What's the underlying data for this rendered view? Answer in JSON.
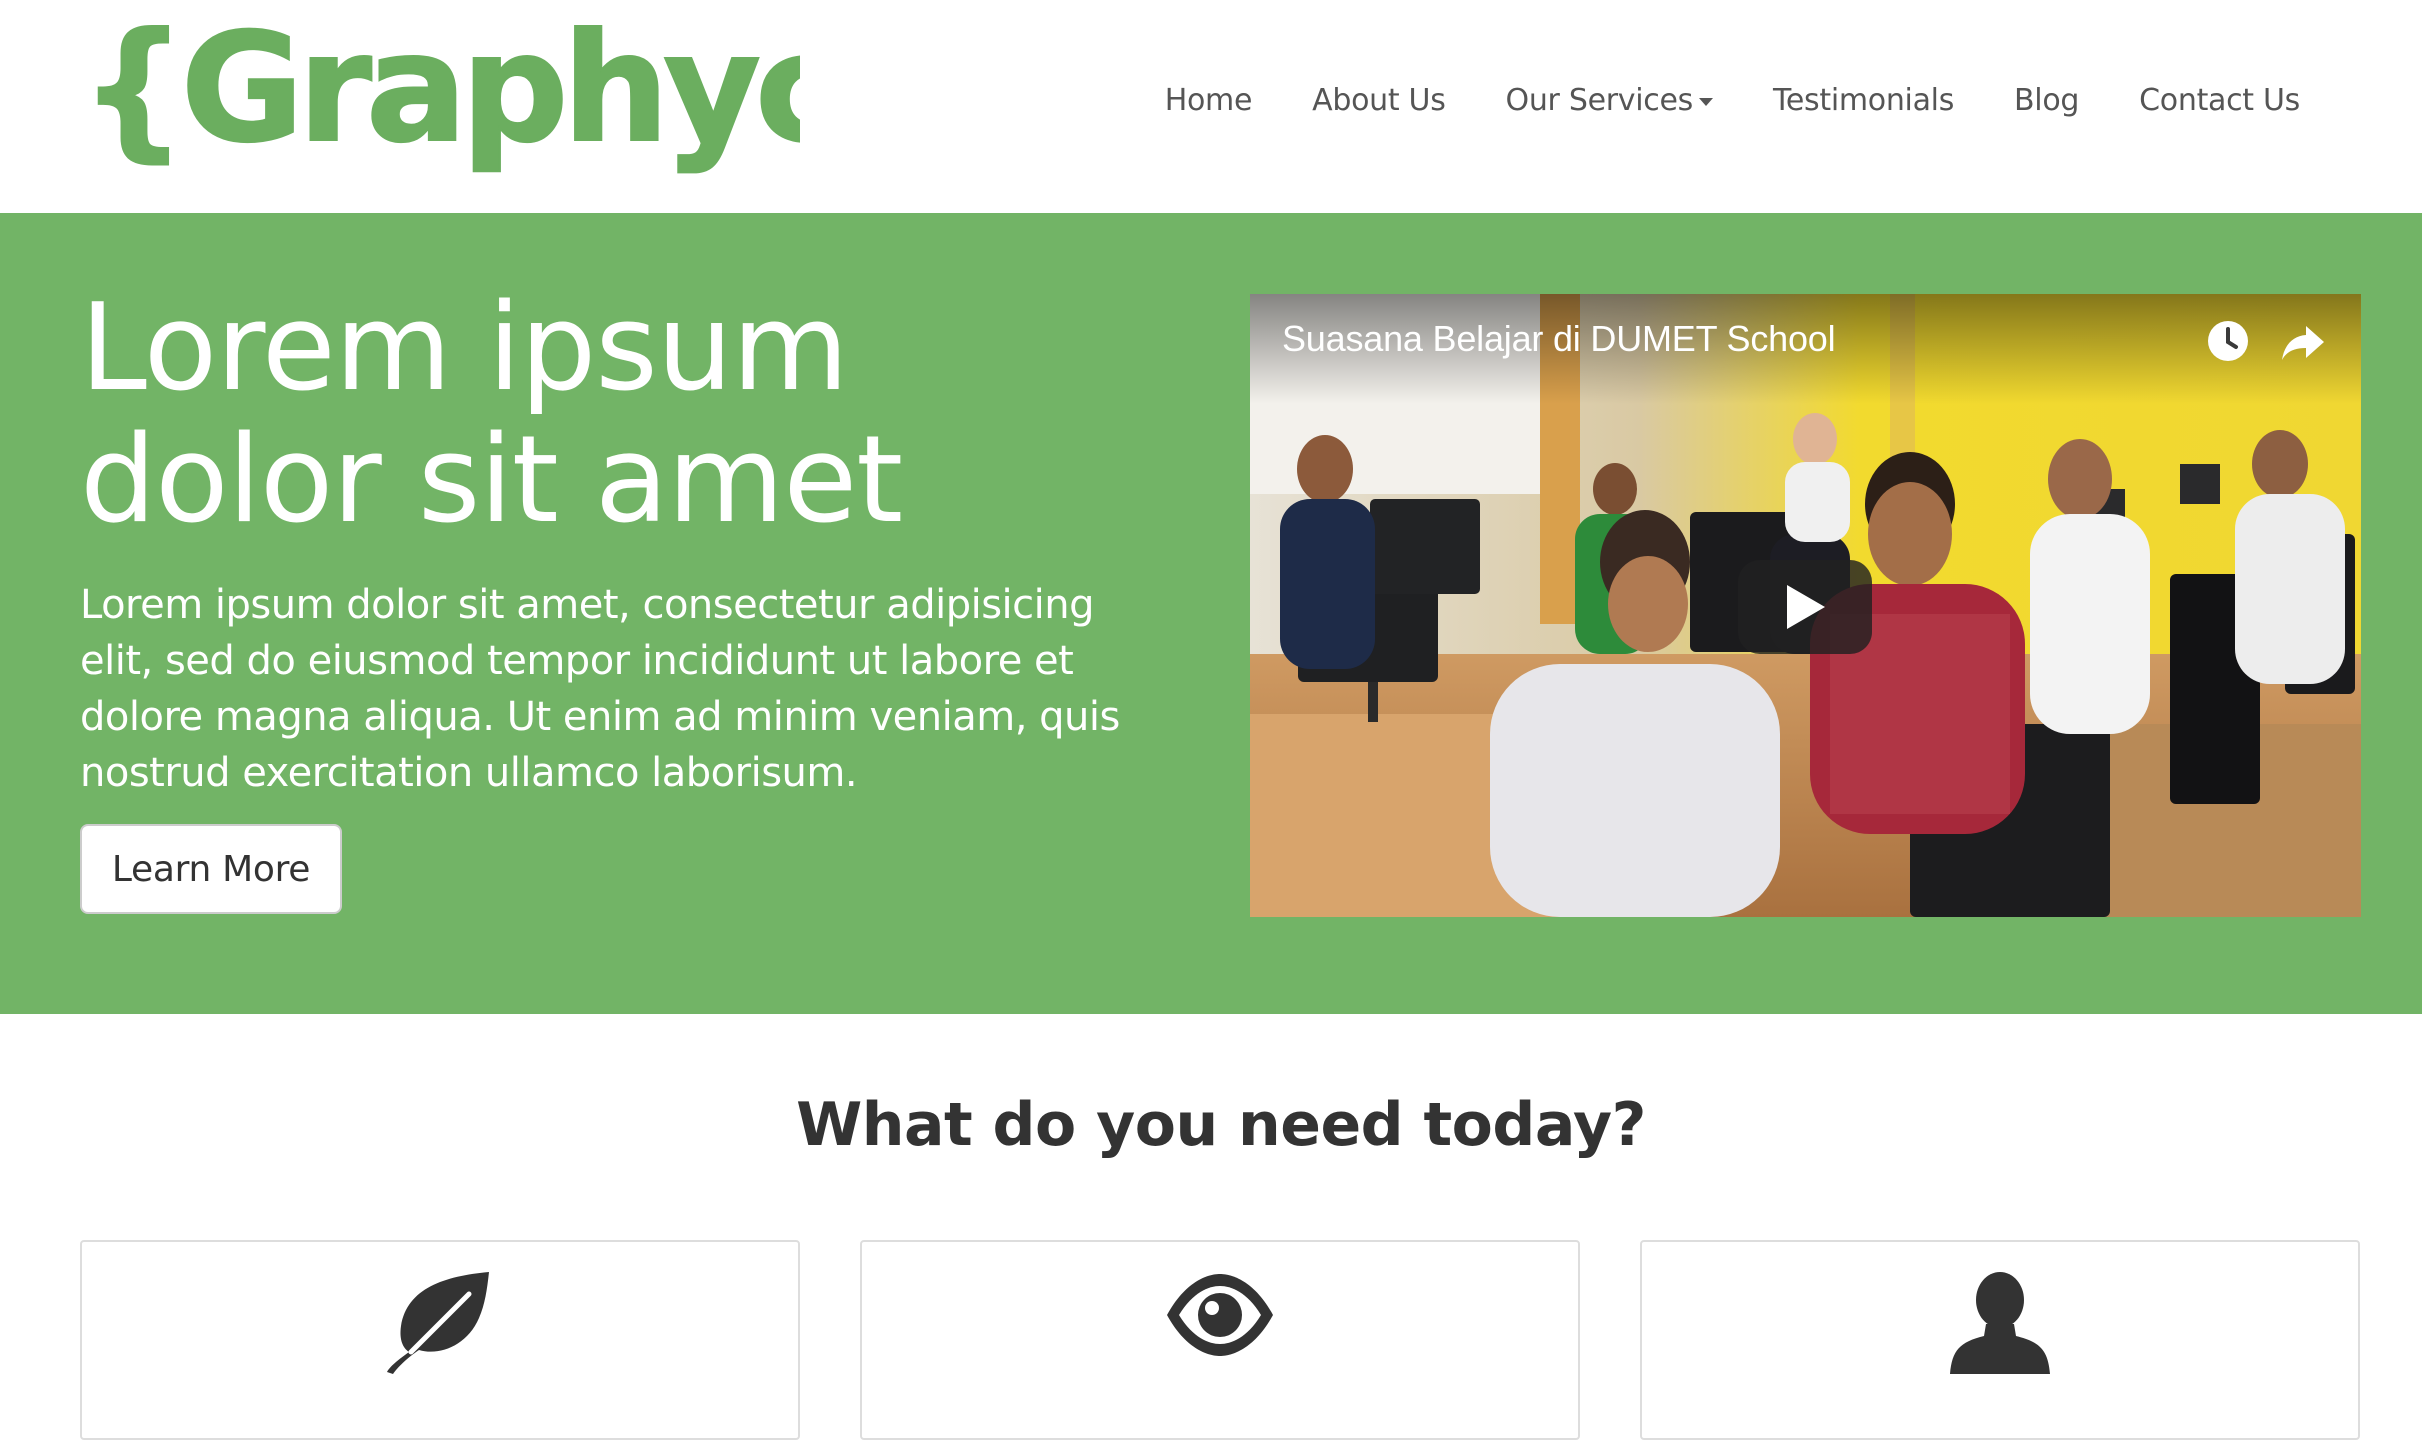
{
  "header": {
    "logo_text": "{Graphyc}",
    "nav": [
      {
        "label": "Home"
      },
      {
        "label": "About Us"
      },
      {
        "label": "Our Services",
        "has_dropdown": true
      },
      {
        "label": "Testimonials"
      },
      {
        "label": "Blog"
      },
      {
        "label": "Contact Us"
      }
    ]
  },
  "hero": {
    "title_line1": "Lorem ipsum",
    "title_line2": "dolor sit amet",
    "text": "Lorem ipsum dolor sit amet, consectetur adipisicing elit, sed do eiusmod tempor incididunt ut labore et dolore magna aliqua. Ut enim ad minim veniam, quis nostrud exercitation ullamco laborisum.",
    "button_label": "Learn More",
    "video": {
      "title": "Suasana Belajar di DUMET School",
      "icons": [
        "watch-later-icon",
        "share-icon",
        "play-icon"
      ]
    }
  },
  "services": {
    "heading": "What do you need today?",
    "cards": [
      {
        "icon": "leaf-icon"
      },
      {
        "icon": "eye-icon"
      },
      {
        "icon": "user-icon"
      }
    ]
  },
  "colors": {
    "brand_green": "#72b466",
    "nav_text": "#555555",
    "heading_text": "#333333",
    "icon_dark": "#333333"
  }
}
